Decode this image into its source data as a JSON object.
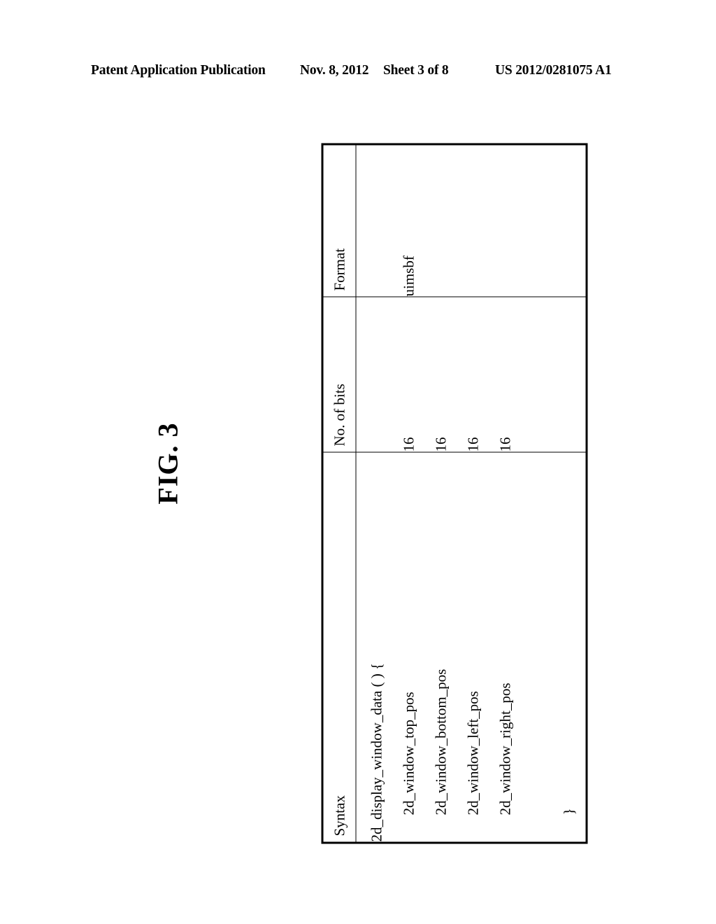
{
  "header": {
    "publication": "Patent Application Publication",
    "date": "Nov. 8, 2012",
    "sheet": "Sheet 3 of 8",
    "doc_number": "US 2012/0281075 A1"
  },
  "figure": {
    "label": "FIG. 3"
  },
  "table": {
    "columns": [
      {
        "key": "syntax",
        "header": "Syntax"
      },
      {
        "key": "bits",
        "header": "No. of bits"
      },
      {
        "key": "format",
        "header": "Format"
      }
    ],
    "rows": [
      {
        "syntax": "2d_display_window_data ( ) {",
        "bits": "",
        "format": ""
      },
      {
        "syntax": "2d_window_top_pos",
        "bits": "16",
        "format": "uimsbf"
      },
      {
        "syntax": "2d_window_bottom_pos",
        "bits": "16",
        "format": ""
      },
      {
        "syntax": "2d_window_left_pos",
        "bits": "16",
        "format": ""
      },
      {
        "syntax": "2d_window_right_pos",
        "bits": "16",
        "format": ""
      },
      {
        "syntax": "}",
        "bits": "",
        "format": ""
      }
    ]
  },
  "colors": {
    "page_background": "#ffffff",
    "ink": "#000000",
    "rule": "#000000"
  }
}
